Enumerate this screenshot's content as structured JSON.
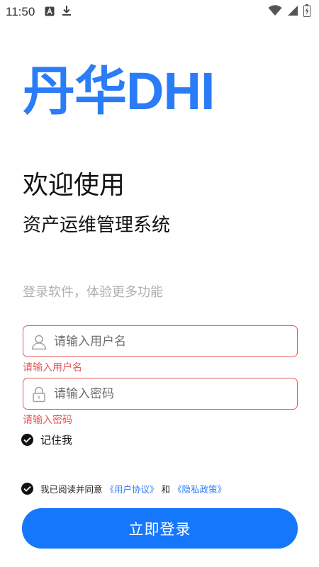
{
  "status_bar": {
    "time": "11:50"
  },
  "logo": {
    "text": "丹华DHI"
  },
  "welcome": {
    "title": "欢迎使用",
    "subtitle": "资产运维管理系统",
    "tagline": "登录软件，体验更多功能"
  },
  "username": {
    "placeholder": "请输入用户名",
    "value": "",
    "error": "请输入用户名"
  },
  "password": {
    "placeholder": "请输入密码",
    "value": "",
    "error": "请输入密码"
  },
  "remember": {
    "label": "记住我",
    "checked": true
  },
  "agreement": {
    "prefix": "我已阅读并同意",
    "user_agreement": "《用户协议》",
    "conjunction": "和",
    "privacy_policy": "《隐私政策》",
    "checked": true
  },
  "login_button": {
    "label": "立即登录"
  },
  "colors": {
    "brand": "#2b7cf7",
    "button": "#1577fb",
    "error": "#e85757"
  }
}
